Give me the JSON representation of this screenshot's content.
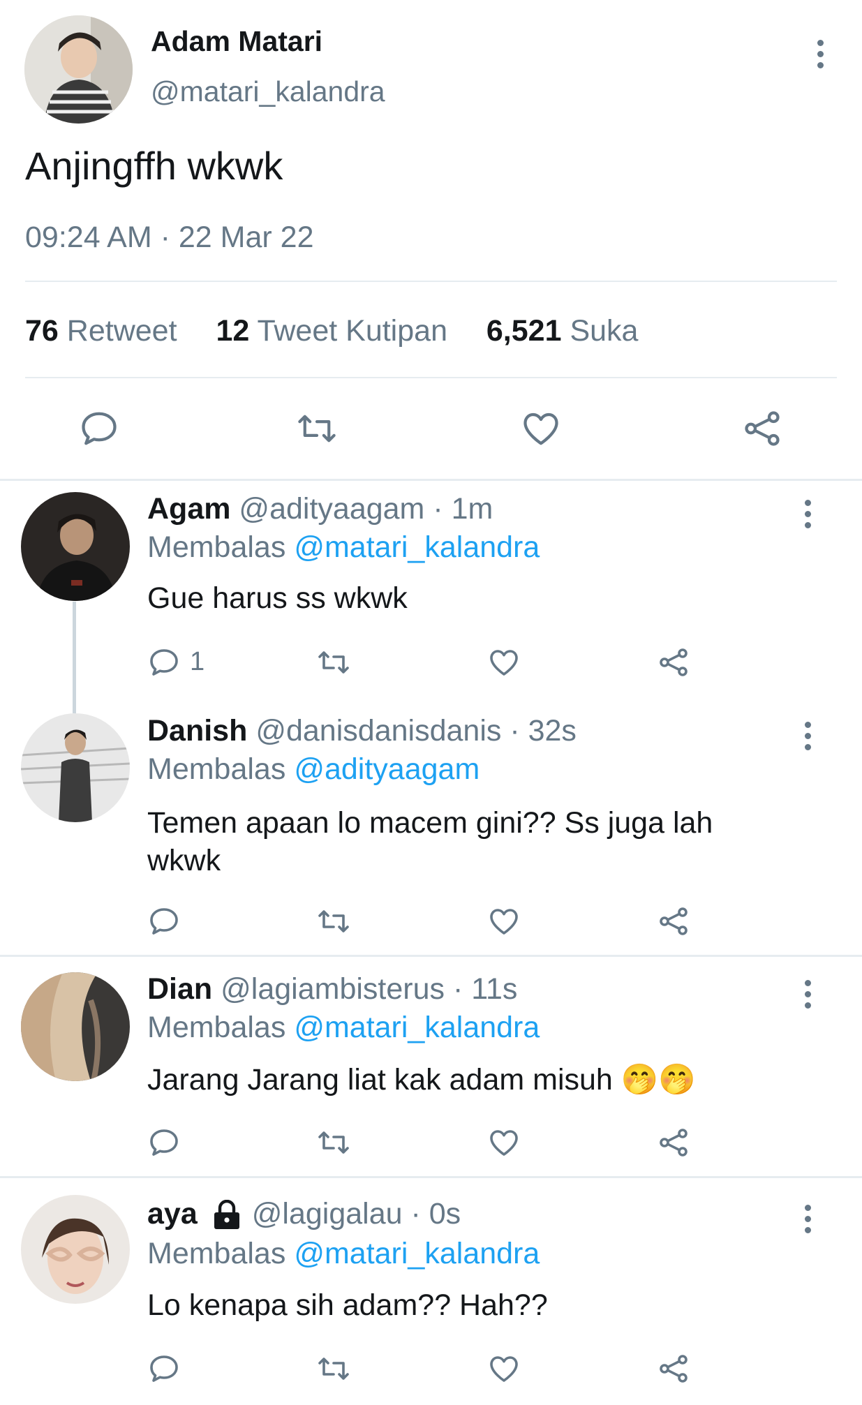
{
  "main_tweet": {
    "name": "Adam Matari",
    "handle": "@matari_kalandra",
    "text": "Anjingffh wkwk",
    "timestamp": "09:24 AM · 22 Mar 22",
    "stats": {
      "retweets": "76",
      "retweets_label": "Retweet",
      "quotes": "12",
      "quotes_label": "Tweet Kutipan",
      "likes": "6,521",
      "likes_label": "Suka"
    }
  },
  "replies": [
    {
      "name": "Agam",
      "meta": "@adityaagam · 1m",
      "replying_label": "Membalas",
      "replying_to": "@matari_kalandra",
      "text": "Gue harus ss wkwk",
      "reply_count": "1"
    },
    {
      "name": "Danish",
      "meta": "@danisdanisdanis · 32s",
      "replying_label": "Membalas",
      "replying_to": "@adityaagam",
      "text_line1": "Temen apaan lo macem gini?? Ss juga lah",
      "text_line2": "wkwk"
    },
    {
      "name": "Dian",
      "meta": "@lagiambisterus · 11s",
      "replying_label": "Membalas",
      "replying_to": "@matari_kalandra",
      "text": "Jarang Jarang liat kak adam misuh",
      "emoji": "🤭🤭"
    },
    {
      "name": "aya",
      "meta": "@lagigalau · 0s",
      "replying_label": "Membalas",
      "replying_to": "@matari_kalandra",
      "text": "Lo kenapa sih adam?? Hah??",
      "lock_icon": "lock-icon"
    }
  ],
  "colors": {
    "accent": "#1da1f2",
    "muted": "#657786",
    "text": "#14171a",
    "divider": "#e6ecf0"
  }
}
